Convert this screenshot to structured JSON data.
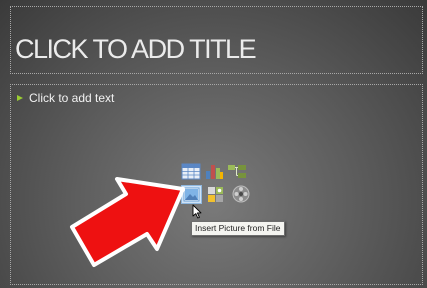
{
  "slide": {
    "title_placeholder": "CLICK TO ADD TITLE",
    "content_placeholder": "Click to add text"
  },
  "content_icons": [
    {
      "name": "insert-table-icon",
      "tooltip": ""
    },
    {
      "name": "insert-chart-icon",
      "tooltip": ""
    },
    {
      "name": "insert-smartart-icon",
      "tooltip": ""
    },
    {
      "name": "insert-picture-icon",
      "tooltip": "Insert Picture from File"
    },
    {
      "name": "insert-clip-art-icon",
      "tooltip": ""
    },
    {
      "name": "insert-media-icon",
      "tooltip": ""
    }
  ],
  "tooltip": {
    "text": "Insert Picture from File"
  },
  "annotation": {
    "arrow_color": "#ee1111"
  },
  "colors": {
    "bullet": "#9acd32",
    "table_blue": "#5b87c5"
  }
}
